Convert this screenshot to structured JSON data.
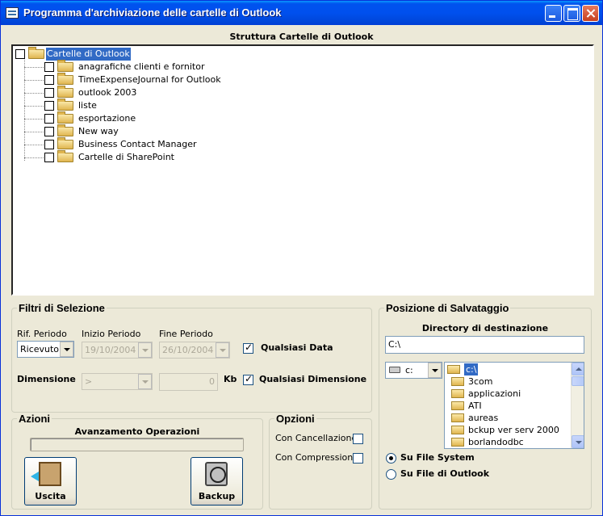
{
  "window": {
    "title": "Programma d'archiviazione delle cartelle di Outlook"
  },
  "tree": {
    "heading": "Struttura Cartelle di Outlook",
    "root": "Cartelle di Outlook",
    "items": [
      "anagrafiche clienti e fornitor",
      "TimeExpenseJournal for Outlook",
      "outlook 2003",
      "liste",
      "esportazione",
      "New way",
      "Business Contact Manager",
      "Cartelle di SharePoint"
    ]
  },
  "filters": {
    "legend": "Filtri di Selezione",
    "rif_periodo_label": "Rif. Periodo",
    "rif_periodo_value": "Ricevuto",
    "inizio_label": "Inizio Periodo",
    "inizio_value": "19/10/2004",
    "fine_label": "Fine Periodo",
    "fine_value": "26/10/2004",
    "qualsiasi_data": "Qualsiasi Data",
    "dimensione_label": "Dimensione",
    "dimensione_op": ">",
    "dimensione_value": "0",
    "kb_label": "Kb",
    "qualsiasi_dimensione": "Qualsiasi Dimensione"
  },
  "actions": {
    "legend": "Azioni",
    "progress_label": "Avanzamento Operazioni",
    "progress": 0,
    "exit_label": "Uscita",
    "backup_label": "Backup"
  },
  "options": {
    "legend": "Opzioni",
    "cancellazione": "Con Cancellazione",
    "compressione": "Con Compressione"
  },
  "destination": {
    "legend": "Posizione di Salvataggio",
    "heading": "Directory di destinazione",
    "path": "C:\\",
    "drive": "c:",
    "dirs": [
      "c:\\",
      "3com",
      "applicazioni",
      "ATI",
      "aureas",
      "bckup ver serv 2000",
      "borlandodbc"
    ],
    "radio_fs": "Su File System",
    "radio_outlook": "Su File di Outlook"
  }
}
